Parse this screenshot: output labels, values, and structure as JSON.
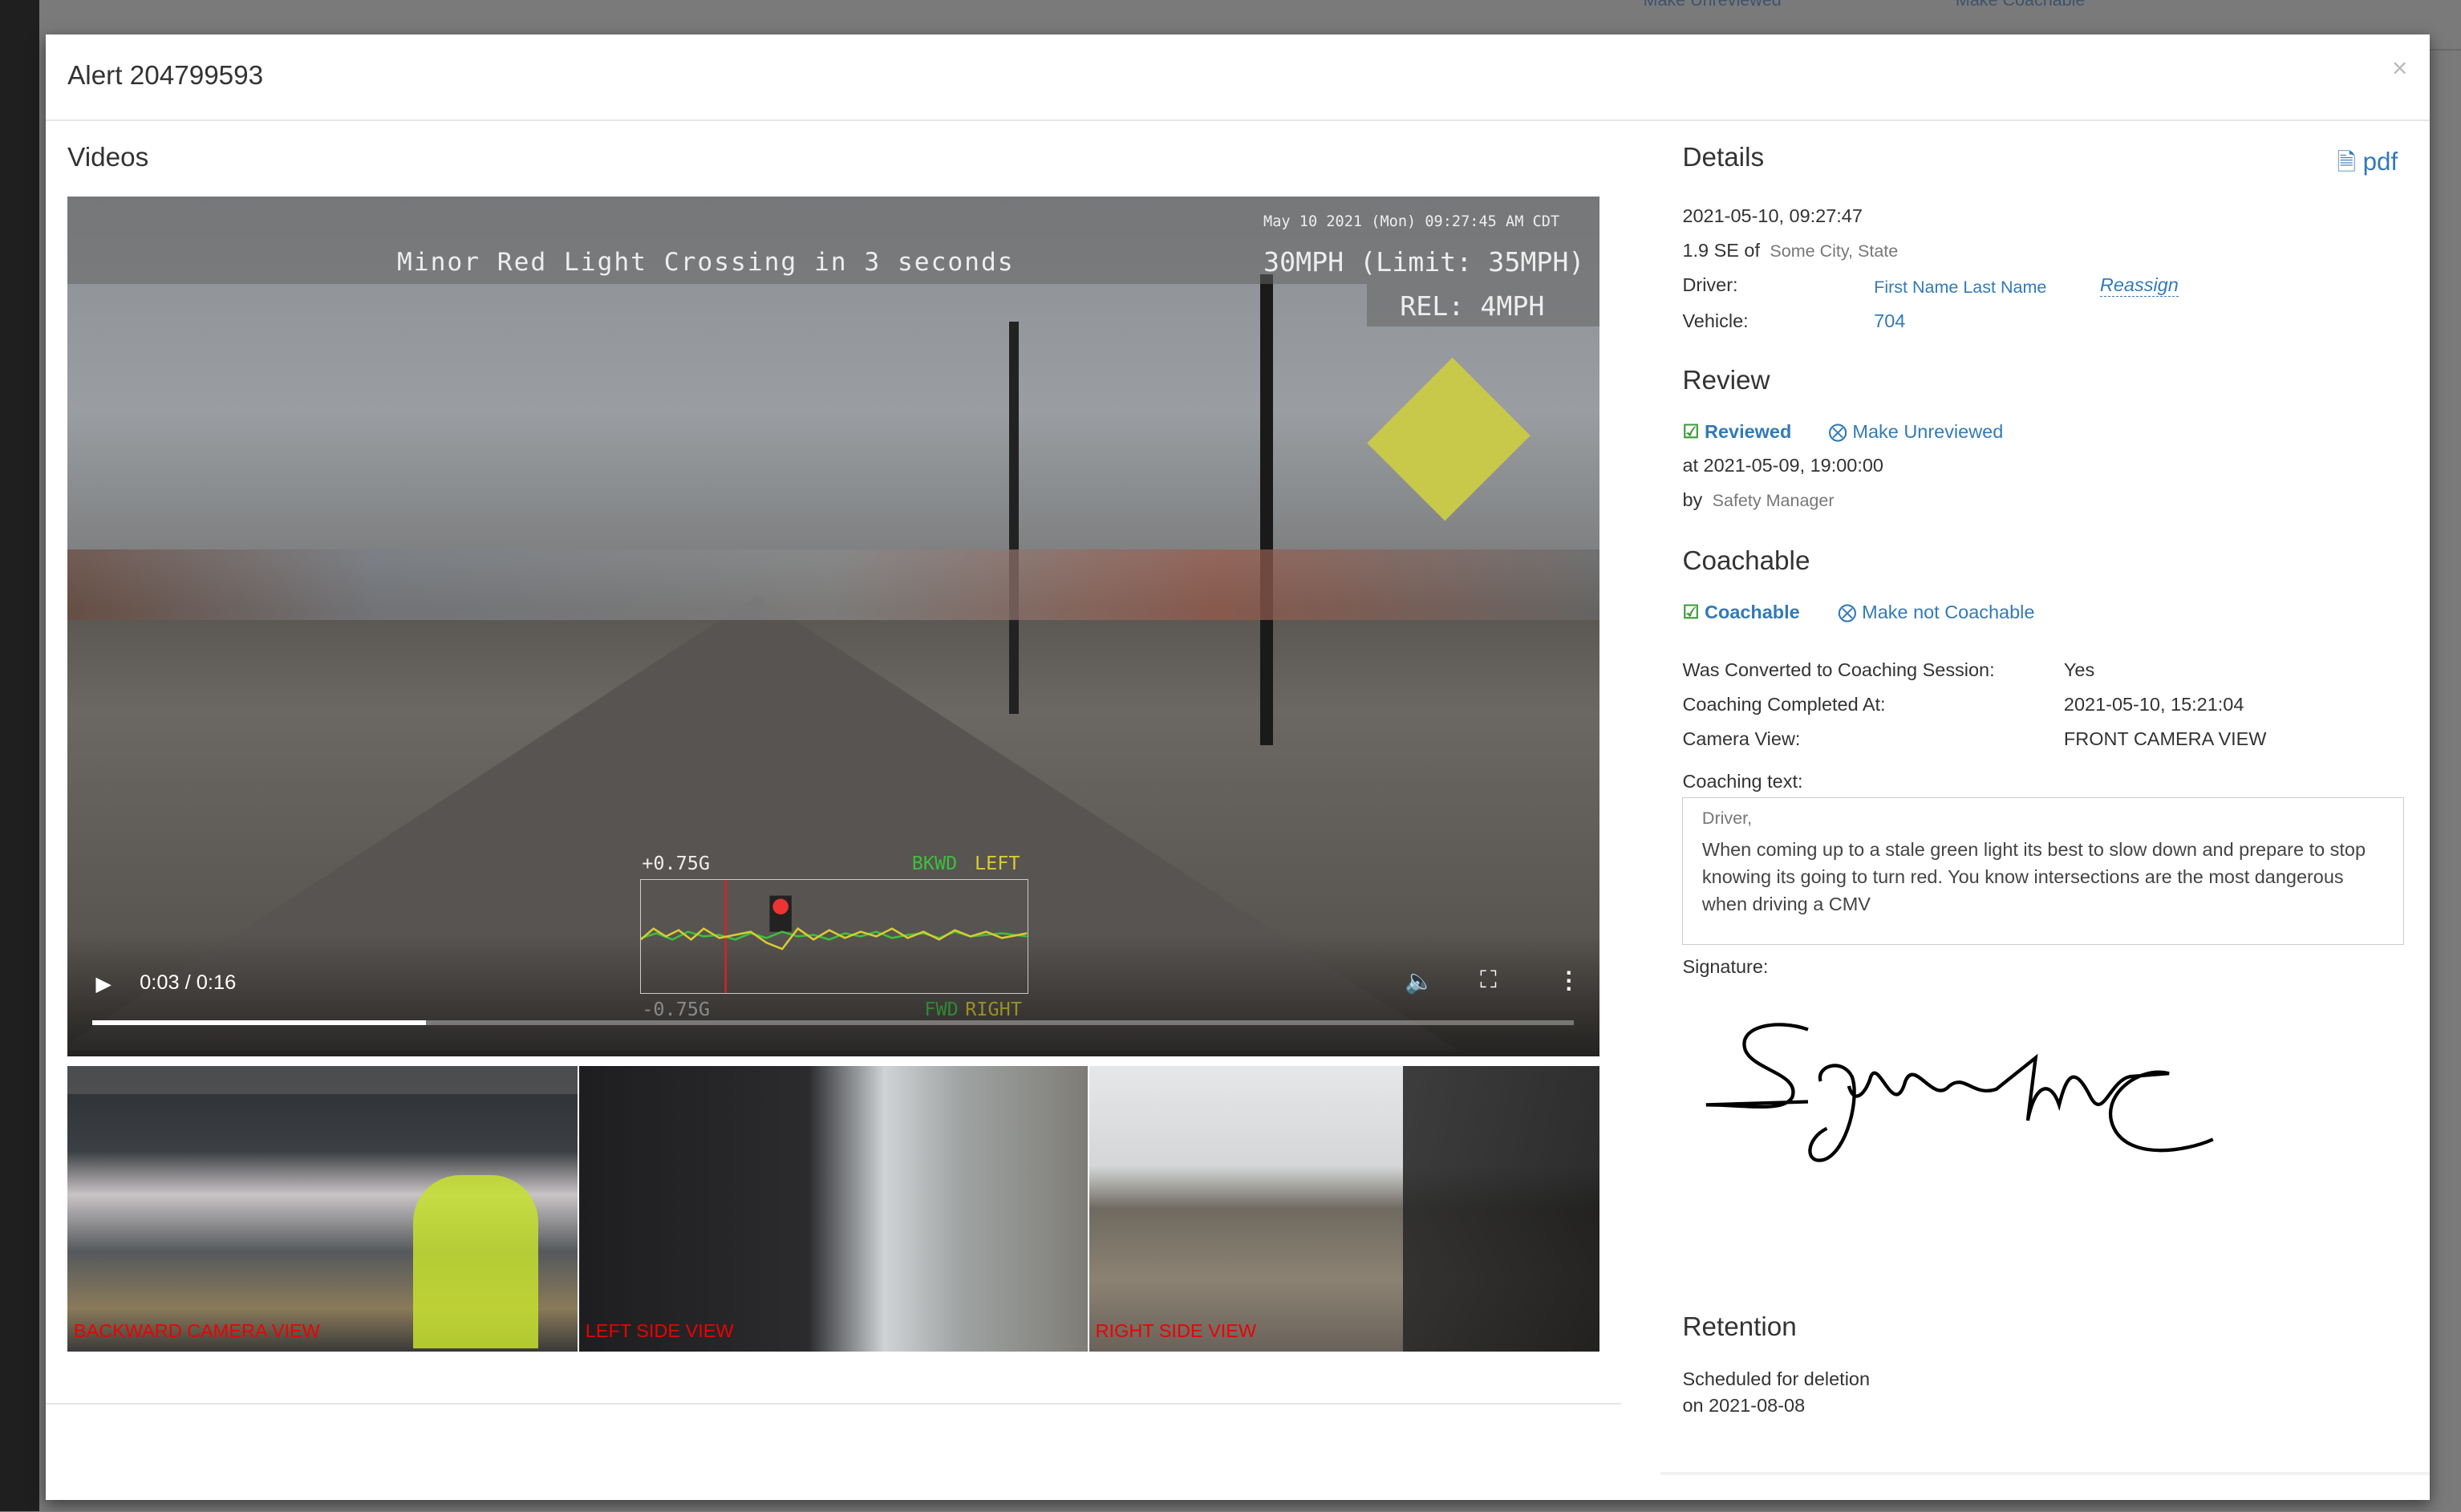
{
  "background": {
    "items": [
      "Make Unreviewed",
      "Make Coachable"
    ]
  },
  "modal": {
    "title": "Alert 204799593",
    "close_label": "×",
    "videos": {
      "heading": "Videos",
      "main": {
        "event_banner": "Minor Red Light Crossing in 3 seconds",
        "timestamp": "May 10 2021 (Mon) 09:27:45 AM CDT",
        "speed": "30MPH (Limit: 35MPH)",
        "relative": "REL: 4MPH",
        "gforce_top": "+0.75G",
        "gforce_bottom": "-0.75G",
        "axis_top_a": "BKWD",
        "axis_top_b": "LEFT",
        "axis_bottom_a": "FWD",
        "axis_bottom_b": "RIGHT",
        "time_display": "0:03 / 0:16",
        "current_seconds": 3,
        "duration_seconds": 16
      },
      "thumbnails": [
        {
          "label": "BACKWARD CAMERA VIEW"
        },
        {
          "label": "LEFT SIDE VIEW"
        },
        {
          "label": "RIGHT SIDE VIEW"
        }
      ]
    },
    "details": {
      "heading": "Details",
      "pdf_label": "pdf",
      "datetime": "2021-05-10, 09:27:47",
      "location_prefix": "1.9 SE of",
      "location": "Some City, State",
      "driver_label": "Driver:",
      "driver_name": "First Name Last Name",
      "reassign_label": "Reassign",
      "vehicle_label": "Vehicle:",
      "vehicle": "704"
    },
    "review": {
      "heading": "Review",
      "status": "Reviewed",
      "action": "Make Unreviewed",
      "at": "at 2021-05-09, 19:00:00",
      "by_label": "by",
      "by": "Safety Manager"
    },
    "coachable": {
      "heading": "Coachable",
      "status": "Coachable",
      "action": "Make not Coachable",
      "fields": [
        {
          "label": "Was Converted to Coaching Session:",
          "value": "Yes"
        },
        {
          "label": "Coaching Completed At:",
          "value": "2021-05-10, 15:21:04"
        },
        {
          "label": "Camera View:",
          "value": "FRONT CAMERA VIEW"
        }
      ],
      "coaching_text_label": "Coaching text:",
      "coaching_text_greeting": "Driver,",
      "coaching_text": "When coming up to a stale green light its best to slow down and prepare to stop knowing its going to turn red. You know intersections are the most dangerous when driving a CMV",
      "signature_label": "Signature:",
      "signature": "Signature"
    },
    "retention": {
      "heading": "Retention",
      "line1": "Scheduled for deletion",
      "line2": "on 2021-08-08"
    }
  },
  "colors": {
    "link": "#337ab7",
    "success": "#3c9a3c",
    "overlay_red": "#e00000"
  }
}
